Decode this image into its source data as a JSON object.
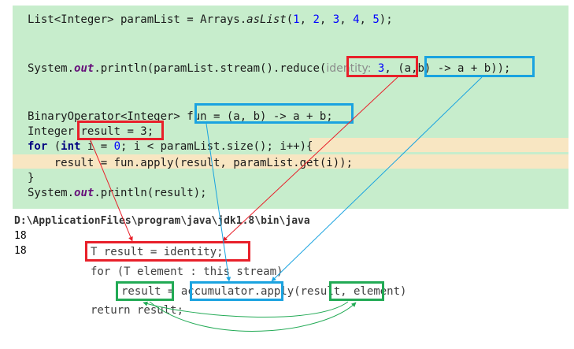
{
  "editor": {
    "line1": {
      "p1": "List<Integer> paramList = Arrays.",
      "asList": "asList",
      "open": "(",
      "n1": "1",
      "n2": "2",
      "n3": "3",
      "n4": "4",
      "n5": "5",
      "close": ");",
      "sep": ", "
    },
    "line2": {
      "p1": "System.",
      "out": "out",
      "p2": ".println(paramList.stream().reduce(",
      "hint": "identity:",
      "identity": "3",
      "p3": ", ",
      "lambda": "(a,b) -> a + b",
      "close": "));"
    },
    "line3": {
      "p1": "BinaryOperator<Integer> ",
      "fun": "fun = (a, b) -> a + b;"
    },
    "line4": {
      "p1": "Integer ",
      "result": "result = 3;"
    },
    "line5": {
      "kw_for": "for",
      "p1": " (",
      "kw_int": "int",
      "p2": " i = ",
      "zero": "0",
      "p3": "; i < paramList.size(); i++){"
    },
    "line6": "    result = fun.apply(result, paramList.get(i));",
    "line7": "}",
    "line8": {
      "p1": "System.",
      "out": "out",
      "p2": ".println(result);"
    }
  },
  "console": {
    "path": "D:\\ApplicationFiles\\program\\java\\jdk1.8\\bin\\java",
    "out1": "18",
    "out2": "18"
  },
  "source": {
    "line1": "T result = identity;",
    "line2": "for (T element : this stream)",
    "result": "result",
    "eq": " = ",
    "accumulator": "accumulator",
    "apply": ".apply",
    "args": "(result,",
    "element": " element)",
    "line4": "return result;"
  },
  "colors": {
    "editor_bg": "#c7edcc",
    "current_line": "#f8e6c2",
    "red": "#e8202a",
    "blue": "#1aa3e0",
    "green": "#22aa55"
  }
}
